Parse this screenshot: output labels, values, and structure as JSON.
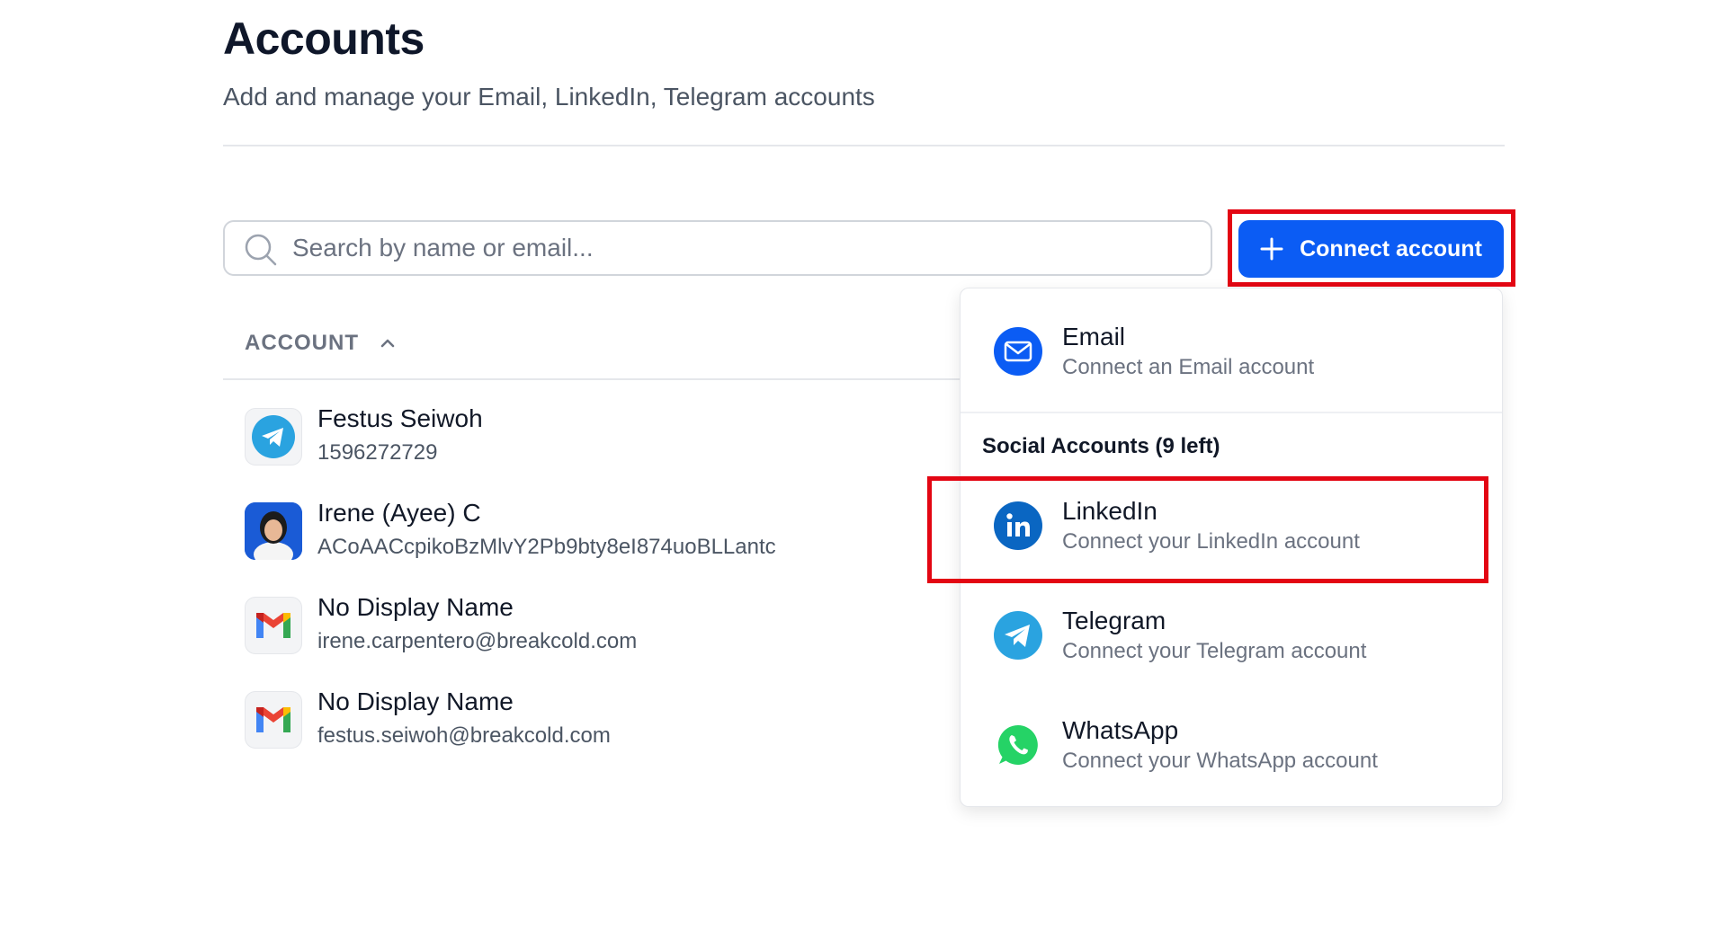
{
  "header": {
    "title": "Accounts",
    "subtitle": "Add and manage your Email, LinkedIn, Telegram accounts"
  },
  "search": {
    "placeholder": "Search by name or email..."
  },
  "toolbar": {
    "connect_label": "Connect account"
  },
  "table": {
    "column_header": "ACCOUNT",
    "sort": "ascending",
    "rows": [
      {
        "name": "Festus Seiwoh",
        "sub": "1596272729",
        "provider_icon": "telegram-icon"
      },
      {
        "name": "Irene (Ayee) C",
        "sub": "ACoAACcpikoBzMlvY2Pb9bty8eI874uoBLLantc",
        "provider_icon": "user-photo-avatar"
      },
      {
        "name": "No Display Name",
        "sub": "irene.carpentero@breakcold.com",
        "provider_icon": "gmail-icon"
      },
      {
        "name": "No Display Name",
        "sub": "festus.seiwoh@breakcold.com",
        "provider_icon": "gmail-icon"
      }
    ]
  },
  "dropdown": {
    "email": {
      "title": "Email",
      "desc": "Connect an Email account",
      "icon": "mail-icon"
    },
    "section_label": "Social Accounts (9 left)",
    "items": [
      {
        "title": "LinkedIn",
        "desc": "Connect your LinkedIn account",
        "icon": "linkedin-icon"
      },
      {
        "title": "Telegram",
        "desc": "Connect your Telegram account",
        "icon": "telegram-icon"
      },
      {
        "title": "WhatsApp",
        "desc": "Connect your WhatsApp account",
        "icon": "whatsapp-icon"
      }
    ]
  },
  "colors": {
    "primary": "#0b5cf4",
    "highlight": "#e30613",
    "linkedin": "#0a66c2",
    "telegram": "#2aa3e0",
    "whatsapp": "#25d366"
  }
}
